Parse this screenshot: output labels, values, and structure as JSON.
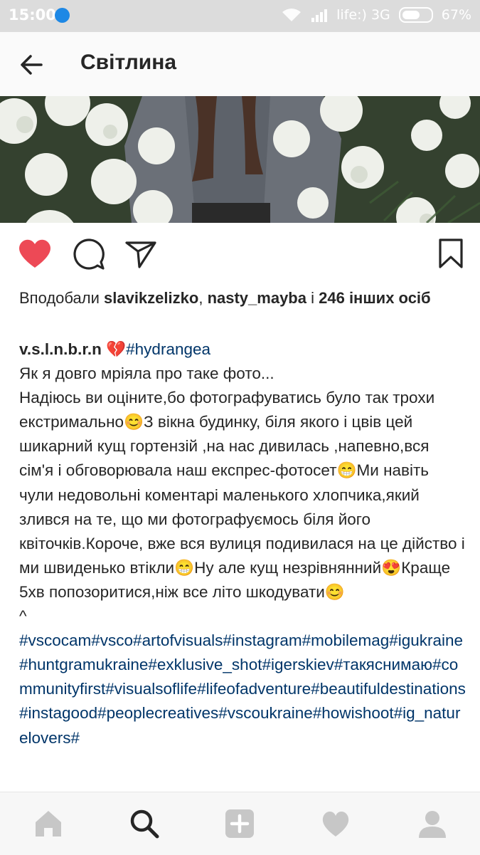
{
  "status_bar": {
    "time": "15:00",
    "carrier": "life:) 3G",
    "battery": "67%"
  },
  "header": {
    "title": "Світлина"
  },
  "likes": {
    "prefix": "Вподобали",
    "user1": "slavikzelizko",
    "sep": ",",
    "user2": "nasty_mayba",
    "and": "і",
    "others": "246 інших осіб"
  },
  "caption": {
    "username": "v.s.l.n.b.r.n",
    "emoji_heart": "💔",
    "hashtag": "#hydrangea",
    "line1": "Як я довго мріяла про таке фото...",
    "body1": "Надіюсь ви оціните,бо фотографуватись було так трохи екстримально",
    "emoji1": "😊",
    "body2": "З вікна будинку, біля якого і цвів цей шикарний кущ гортензій ,на нас дивилась ,напевно,вся сім'я і обговорювала наш експрес-фотосет",
    "emoji2": "😁",
    "body3": "Ми навіть чули недовольні коментарі маленького хлопчика,який злився на те, що ми фотографуємось біля його квіточків.Короче, вже вся вулиця подивилася на це дійство і ми швиденько втікли",
    "emoji3": "😁",
    "body4": "Ну але кущ незрівнянний",
    "emoji4": "😍",
    "body5": "Краще 5хв попозоритися,ніж все літо шкодувати",
    "emoji5": "😊",
    "caret": "^",
    "hashtags": "#vscocam#vsco#artofvisuals#instagram#mobilemag#igukraine#huntgramukraine#exklusive_shot#igerskiev#такяснимаю#communityfirst#visualsoflife#lifeofadventure#beautifuldestinations#instagood#peoplecreatives#vscoukraine#howishoot#ig_naturelovers#"
  },
  "colors": {
    "like_red": "#ed4956",
    "hashtag_blue": "#003569",
    "status_bar": "#dcdcdc"
  },
  "icons": [
    "back-arrow-icon",
    "heart-icon",
    "comment-icon",
    "send-icon",
    "bookmark-icon",
    "home-icon",
    "search-icon",
    "add-icon",
    "activity-heart-icon",
    "profile-icon"
  ]
}
